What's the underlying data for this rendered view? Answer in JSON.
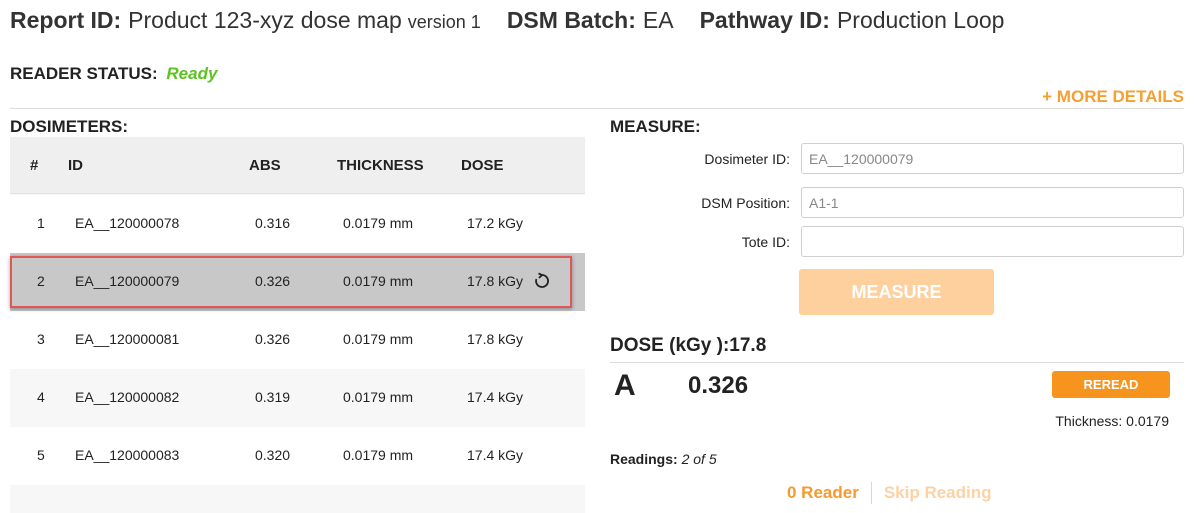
{
  "header": {
    "report_label": "Report ID:",
    "report_value": "Product 123-xyz dose map",
    "report_version": "version 1",
    "dsm_label": "DSM Batch:",
    "dsm_value": "EA",
    "pathway_label": "Pathway ID:",
    "pathway_value": "Production Loop"
  },
  "reader_status": {
    "label": "READER STATUS:",
    "value": "Ready"
  },
  "more_details": "+ MORE DETAILS",
  "dosimeters": {
    "title": "DOSIMETERS:",
    "columns": [
      "#",
      "ID",
      "ABS",
      "THICKNESS",
      "DOSE"
    ],
    "rows": [
      {
        "num": "1",
        "id": "EA__120000078",
        "abs": "0.316",
        "thickness": "0.0179 mm",
        "dose": "17.2 kGy"
      },
      {
        "num": "2",
        "id": "EA__120000079",
        "abs": "0.326",
        "thickness": "0.0179 mm",
        "dose": "17.8 kGy"
      },
      {
        "num": "3",
        "id": "EA__120000081",
        "abs": "0.326",
        "thickness": "0.0179 mm",
        "dose": "17.8 kGy"
      },
      {
        "num": "4",
        "id": "EA__120000082",
        "abs": "0.319",
        "thickness": "0.0179 mm",
        "dose": "17.4 kGy"
      },
      {
        "num": "5",
        "id": "EA__120000083",
        "abs": "0.320",
        "thickness": "0.0179 mm",
        "dose": "17.4 kGy"
      }
    ],
    "selected_row": 2
  },
  "measure": {
    "title": "MEASURE:",
    "dosimeter_id_label": "Dosimeter ID:",
    "dosimeter_id_placeholder": "EA__120000079",
    "dsm_position_label": "DSM Position:",
    "dsm_position_placeholder": "A1-1",
    "tote_id_label": "Tote ID:",
    "tote_id_value": "",
    "measure_button": "MEASURE"
  },
  "dose": {
    "title": "DOSE (kGy ):17.8",
    "position_letter": "A",
    "abs_value": "0.326",
    "reread_button": "REREAD",
    "thickness": "Thickness: 0.0179"
  },
  "readings": {
    "label": "Readings:",
    "current": "2",
    "of": "of",
    "total": "5"
  },
  "footer": {
    "reader_link": "0 Reader",
    "skip_link": "Skip Reading"
  },
  "colors": {
    "ready": "#5cc41e",
    "accent": "#f7941d",
    "measure_disabled": "#fdd09e",
    "selected_row": "#c8c8c8",
    "selected_outline": "#e05555"
  },
  "icons": {
    "reread_row": "refresh-icon"
  }
}
